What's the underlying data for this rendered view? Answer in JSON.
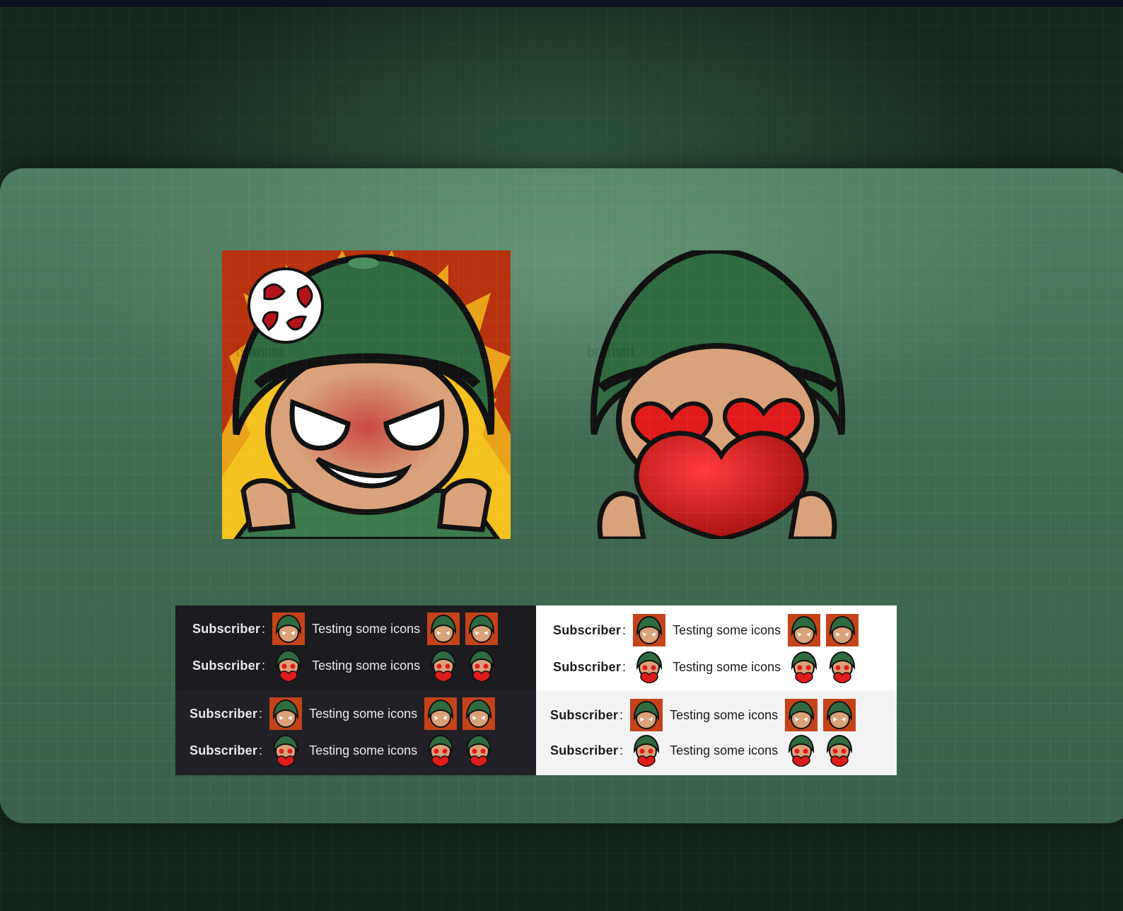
{
  "preview": {
    "dark": {
      "rows": [
        {
          "name": "Subscriber",
          "colon": ":",
          "message": "Testing some icons",
          "emote": "angry-soldier-emote"
        },
        {
          "name": "Subscriber",
          "colon": ":",
          "message": "Testing some icons",
          "emote": "love-soldier-emote"
        },
        {
          "name": "Subscriber",
          "colon": ":",
          "message": "Testing some icons",
          "emote": "angry-soldier-emote"
        },
        {
          "name": "Subscriber",
          "colon": ":",
          "message": "Testing some icons",
          "emote": "love-soldier-emote"
        }
      ]
    },
    "light": {
      "rows": [
        {
          "name": "Subscriber",
          "colon": ":",
          "message": "Testing some icons",
          "emote": "angry-soldier-emote"
        },
        {
          "name": "Subscriber",
          "colon": ":",
          "message": "Testing some icons",
          "emote": "love-soldier-emote"
        },
        {
          "name": "Subscriber",
          "colon": ":",
          "message": "Testing some icons",
          "emote": "angry-soldier-emote"
        },
        {
          "name": "Subscriber",
          "colon": ":",
          "message": "Testing some icons",
          "emote": "love-soldier-emote"
        }
      ]
    }
  },
  "emotes": {
    "angry": {
      "icon": "angry-soldier-emote",
      "watermark": "branstd"
    },
    "love": {
      "icon": "love-soldier-emote",
      "watermark": "branstd"
    }
  },
  "colors": {
    "panel": "#3f6b51",
    "helmet": "#2f6a40",
    "heart": "#e01b1b",
    "skin": "#d9a27a",
    "dark_bg": "#1b1b20",
    "light_bg": "#ffffff"
  }
}
